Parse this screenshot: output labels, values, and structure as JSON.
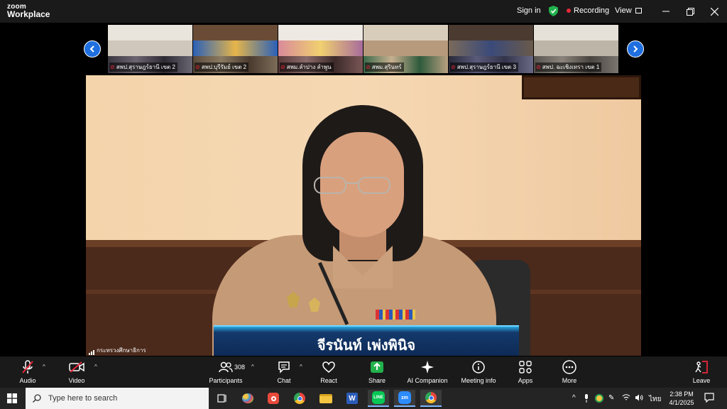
{
  "app": {
    "logo_line1": "zoom",
    "logo_line2": "Workplace"
  },
  "titlebar": {
    "signin": "Sign in",
    "recording": "Recording",
    "view": "View",
    "shield_color": "#22b24c",
    "record_color": "#e8283b"
  },
  "gallery": {
    "thumbnails": [
      {
        "label": "สพป.สุราษฎร์ธานี เขต 2"
      },
      {
        "label": "สพป.บุรีรัมย์ เขต 2"
      },
      {
        "label": "สพม.ลำปาง ลำพูน"
      },
      {
        "label": "สพม.สุรินทร์"
      },
      {
        "label": "สพป.สุราษฎร์ธานี เขต 3"
      },
      {
        "label": "สพป. ฉะเชิงเทรา เขต 1"
      }
    ],
    "prev_icon": "chevron-left-icon",
    "next_icon": "chevron-right-icon"
  },
  "speaker": {
    "name": "จีรนันท์ เพ่งพินิจ",
    "source_label": "กระทรวงศึกษาธิการ"
  },
  "toolbar": {
    "audio": "Audio",
    "video": "Video",
    "participants": "Participants",
    "participants_count": "308",
    "chat": "Chat",
    "react": "React",
    "share": "Share",
    "ai_companion": "AI Companion",
    "meeting_info": "Meeting info",
    "apps": "Apps",
    "more": "More",
    "leave": "Leave",
    "share_color": "#22b24c",
    "leave_color": "#e8283b"
  },
  "taskbar": {
    "search_placeholder": "Type here to search",
    "lang": "ไทย",
    "time": "2:38 PM",
    "date": "4/1/2025"
  }
}
